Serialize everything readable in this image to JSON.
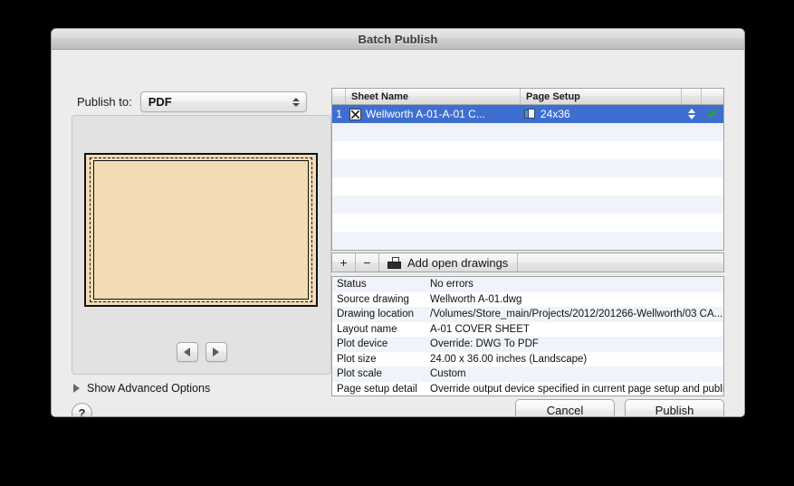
{
  "window": {
    "title": "Batch Publish"
  },
  "publish_to": {
    "label": "Publish to:",
    "value": "PDF"
  },
  "preview": {
    "prev_glyph": "",
    "next_glyph": ""
  },
  "sheet_list": {
    "columns": [
      "",
      "Sheet Name",
      "Page Setup",
      "",
      ""
    ],
    "rows": [
      {
        "number": "1",
        "sheet_name": "Wellworth A-01-A-01 C...",
        "page_setup": "24x36",
        "check": "✔"
      }
    ]
  },
  "list_toolbar": {
    "add_label": "+",
    "remove_label": "−",
    "add_open_drawings": "Add open drawings"
  },
  "details": [
    {
      "key": "Status",
      "value": "No errors"
    },
    {
      "key": "Source drawing",
      "value": "Wellworth A-01.dwg"
    },
    {
      "key": "Drawing location",
      "value": "/Volumes/Store_main/Projects/2012/201266-Wellworth/03 CA..."
    },
    {
      "key": "Layout name",
      "value": "A-01 COVER SHEET"
    },
    {
      "key": "Plot device",
      "value": "Override: DWG To PDF"
    },
    {
      "key": "Plot size",
      "value": "24.00 x 36.00 inches (Landscape)"
    },
    {
      "key": "Plot scale",
      "value": "Custom"
    },
    {
      "key": "Page setup detail",
      "value": "Override output device specified in current page setup and publi..."
    }
  ],
  "advanced": {
    "label": "Show Advanced Options"
  },
  "help": {
    "glyph": "?"
  },
  "buttons": {
    "cancel": "Cancel",
    "publish": "Publish"
  },
  "colors": {
    "selection_blue": "#3E6FD0",
    "row_stripe": "#F0F4FA",
    "checkmark_green": "#2AA62A",
    "paper_fill": "#F2DCB6",
    "window_bg": "#ECECEC"
  }
}
